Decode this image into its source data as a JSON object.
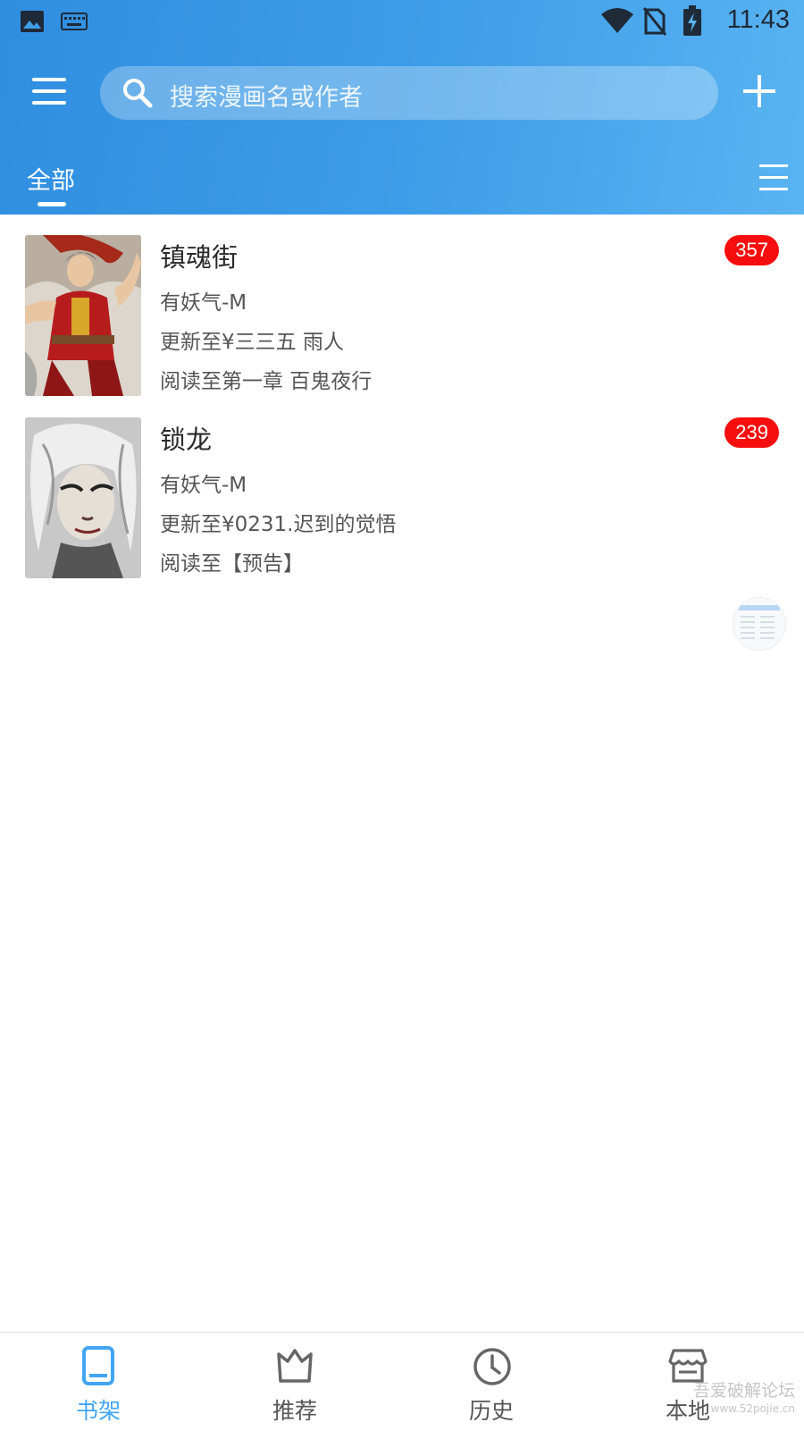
{
  "status_bar": {
    "time": "11:43",
    "icons": [
      "image-icon",
      "keyboard-icon",
      "wifi-icon",
      "no-sim-icon",
      "battery-charging-icon"
    ]
  },
  "toolbar": {
    "search_placeholder": "搜索漫画名或作者",
    "menu_icon": "hamburger-menu-icon",
    "add_icon": "plus-icon"
  },
  "tabs": {
    "active": "全部"
  },
  "books": [
    {
      "title": "镇魂街",
      "author": "有妖气-M",
      "update": "更新至¥三三五 雨人",
      "read": "阅读至第一章 百鬼夜行",
      "badge": "357"
    },
    {
      "title": "锁龙",
      "author": "有妖气-M",
      "update": "更新至¥0231.迟到的觉悟",
      "read": "阅读至【预告】",
      "badge": "239"
    }
  ],
  "bottom_nav": [
    {
      "label": "书架",
      "icon": "book-icon",
      "active": true
    },
    {
      "label": "推荐",
      "icon": "crown-icon",
      "active": false
    },
    {
      "label": "历史",
      "icon": "clock-icon",
      "active": false
    },
    {
      "label": "本地",
      "icon": "store-icon",
      "active": false
    }
  ],
  "watermark": {
    "text": "吾爱破解论坛",
    "url": "www.52pojie.cn"
  },
  "colors": {
    "header_start": "#2f8ee0",
    "header_end": "#5ab4f2",
    "badge": "#f60d0d",
    "nav_active": "#42a5f5"
  }
}
